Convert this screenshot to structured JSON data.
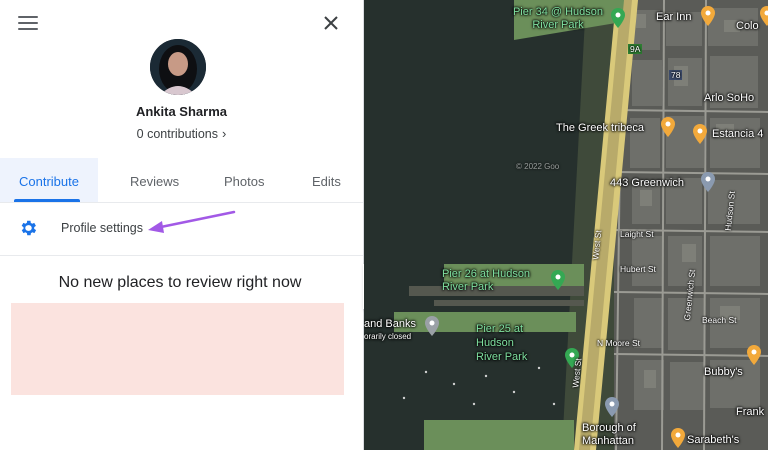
{
  "panel": {
    "user_name": "Ankita Sharma",
    "contributions": "0 contributions",
    "tabs": [
      {
        "label": "Contribute",
        "active": true
      },
      {
        "label": "Reviews",
        "active": false
      },
      {
        "label": "Photos",
        "active": false
      },
      {
        "label": "Edits",
        "active": false
      }
    ],
    "profile_settings_label": "Profile settings",
    "empty_message": "No new places to review right now"
  },
  "icons": {
    "menu": "hamburger-icon",
    "close": "close-icon",
    "settings": "gear-icon",
    "chevron": "chevron-right-icon",
    "collapse": "chevron-left-icon"
  },
  "colors": {
    "accent": "#1a73e8",
    "tab_highlight": "#eef3fd",
    "pink_block": "#fbe3df",
    "annotation_arrow": "#a259e6",
    "park_pin": "#34a853",
    "food_pin": "#f2a93b"
  },
  "map": {
    "places": {
      "pier34": "Pier 34 @ Hudson River Park",
      "ear_inn": "Ear Inn",
      "color": "Colo",
      "arlo": "Arlo SoHo",
      "greek": "The Greek tribeca",
      "estancia": "Estancia 4",
      "greenwich": "443 Greenwich",
      "pier26": "Pier 26 at Hudson River Park",
      "pier25": "Pier 25 at Hudson River Park",
      "sand_banks": "and Banks",
      "temp_closed": "orarily closed",
      "bubbys": "Bubby's",
      "frank": "Frank",
      "borough": "Borough of Manhattan",
      "sarabeth": "Sarabeth's"
    },
    "streets": {
      "west_st": "West St",
      "west_st2": "West St",
      "hudson_st": "Hudson St",
      "greenwich_st": "Greenwich St",
      "laight_st": "Laight St",
      "hubert_st": "Hubert St",
      "beach_st": "Beach St",
      "n_moore_st": "N Moore St",
      "route_9a": "9A",
      "route_78": "78"
    },
    "watermark": "© 2022 Goo"
  }
}
